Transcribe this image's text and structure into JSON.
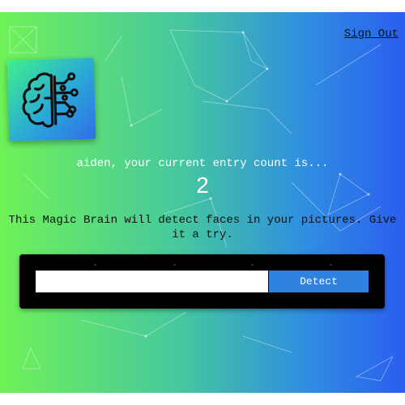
{
  "nav": {
    "signout_label": "Sign Out"
  },
  "logo": {
    "icon": "brain-circuit-icon"
  },
  "rank": {
    "message": "aiden, your current entry count is...",
    "count": "2"
  },
  "image_form": {
    "description": "This Magic Brain will detect faces in your pictures. Give it a try.",
    "input_value": "",
    "button_label": "Detect"
  },
  "colors": {
    "gradient_left": "#6ff257",
    "gradient_right": "#2a5ef0",
    "button": "#2f82e0",
    "form_background": "#000000"
  }
}
